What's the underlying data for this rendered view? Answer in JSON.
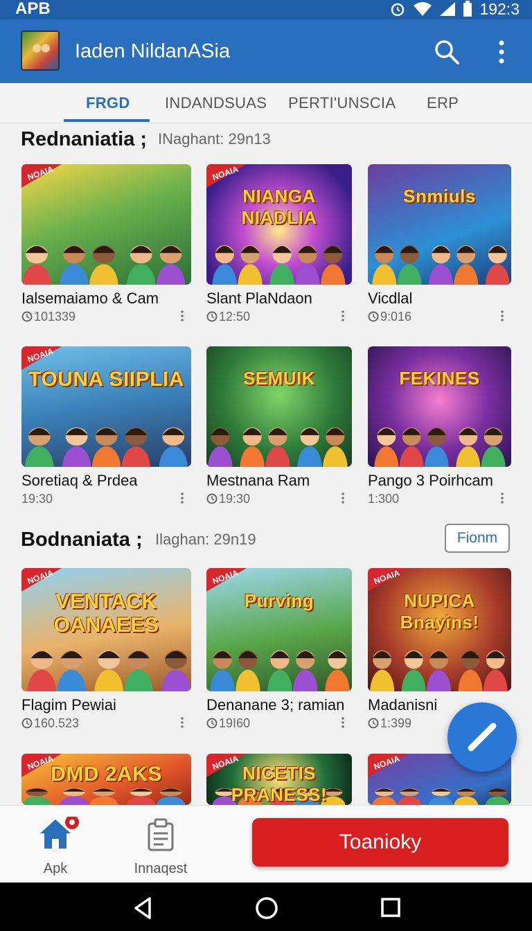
{
  "status_bar": {
    "carrier": "APB",
    "time": "192:3"
  },
  "app_bar": {
    "title": "Iaden NildanASia"
  },
  "tabs": [
    {
      "label": "FRGD",
      "active": true
    },
    {
      "label": "INDANDSUAS",
      "active": false
    },
    {
      "label": "PERTI'UNSCIA",
      "active": false
    },
    {
      "label": "ERP",
      "active": false
    }
  ],
  "sections": [
    {
      "title": "Rednaniatia ;",
      "subtitle": "INaghant: 29n13"
    },
    {
      "title": "Bodnaniata ;",
      "subtitle": "Ilaghan: 29n19",
      "filter_label": "Fionm"
    }
  ],
  "cards": [
    {
      "title": "Ialsemaiamo & Cam",
      "meta": "101339",
      "has_clock": true,
      "badge": "NOAIA",
      "logo": ""
    },
    {
      "title": "Slant PlaNdaon",
      "meta": "12:50",
      "has_clock": true,
      "badge": "NOAIA",
      "logo": "NIANGA NIADLIA"
    },
    {
      "title": "Vicdlal",
      "meta": "9:016",
      "has_clock": true,
      "badge": "",
      "logo": "Snmiuls"
    },
    {
      "title": "Soretiaq & Prdea",
      "meta": "19:30",
      "has_clock": false,
      "badge": "NOAIA",
      "logo": "TOUNA SIIPLIA"
    },
    {
      "title": "Mestnana Ram",
      "meta": "19:30",
      "has_clock": true,
      "badge": "",
      "logo": "SEMUIK"
    },
    {
      "title": "Pango 3 Poirhcam",
      "meta": "1:300",
      "has_clock": false,
      "badge": "",
      "logo": "FEKINES"
    },
    {
      "title": "Flagim Pewiai",
      "meta": "160.523",
      "has_clock": true,
      "badge": "NOAIA",
      "logo": "VENTACK OANAEES"
    },
    {
      "title": "Denanane 3; ramian",
      "meta": "19I60",
      "has_clock": true,
      "badge": "NOAIA",
      "logo": "Purving"
    },
    {
      "title": "Madanisni",
      "meta": "1:399",
      "has_clock": true,
      "badge": "NOAIA",
      "logo": "NUPICA Bnayins!"
    },
    {
      "title": "",
      "meta": "",
      "has_clock": false,
      "badge": "NOAIA",
      "logo": "DMD 2AKS"
    },
    {
      "title": "",
      "meta": "",
      "has_clock": false,
      "badge": "NOAIA",
      "logo": "NICETIS PRANESS!"
    },
    {
      "title": "",
      "meta": "",
      "has_clock": false,
      "badge": "NOAIA",
      "logo": ""
    }
  ],
  "bottom_nav": {
    "home_label": "Apk",
    "requests_label": "Innaqest",
    "cta_label": "Toanioky"
  },
  "colors": {
    "primary": "#2a6fbe",
    "accent_red": "#d71f1f",
    "fab": "#2a77d6"
  }
}
